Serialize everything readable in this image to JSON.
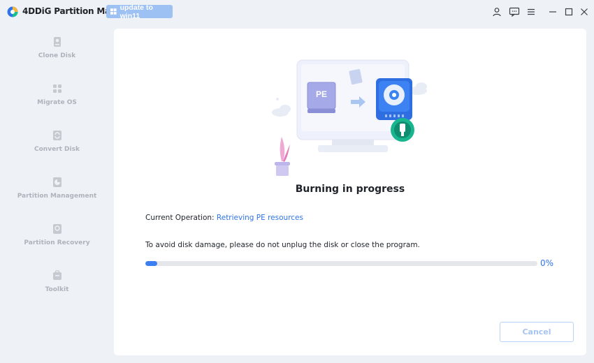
{
  "app": {
    "title": "4DDiG Partition Manager",
    "update_label": "update to win11"
  },
  "titlebar_icons": [
    "account-icon",
    "feedback-icon",
    "menu-icon",
    "minimize-icon",
    "maximize-icon",
    "close-icon"
  ],
  "sidebar": {
    "items": [
      {
        "label": "Clone Disk",
        "icon": "clone-disk-icon"
      },
      {
        "label": "Migrate OS",
        "icon": "migrate-os-icon"
      },
      {
        "label": "Convert Disk",
        "icon": "convert-disk-icon"
      },
      {
        "label": "Partition Management",
        "icon": "partition-management-icon"
      },
      {
        "label": "Partition Recovery",
        "icon": "partition-recovery-icon"
      },
      {
        "label": "Toolkit",
        "icon": "toolkit-icon"
      }
    ]
  },
  "main": {
    "illustration": {
      "pe_label": "PE"
    },
    "heading": "Burning in progress",
    "operation_label": "Current Operation: ",
    "operation_value": "Retrieving PE resources",
    "warning": "To avoid disk damage, please do not unplug the disk or close the program.",
    "progress_value": 0,
    "progress_text": "0%",
    "cancel_label": "Cancel"
  },
  "colors": {
    "accent": "#2f74e8",
    "update_button": "#9ec1f3",
    "sidebar_text": "#aeb3bb",
    "progress_track": "#e4e6ea"
  }
}
